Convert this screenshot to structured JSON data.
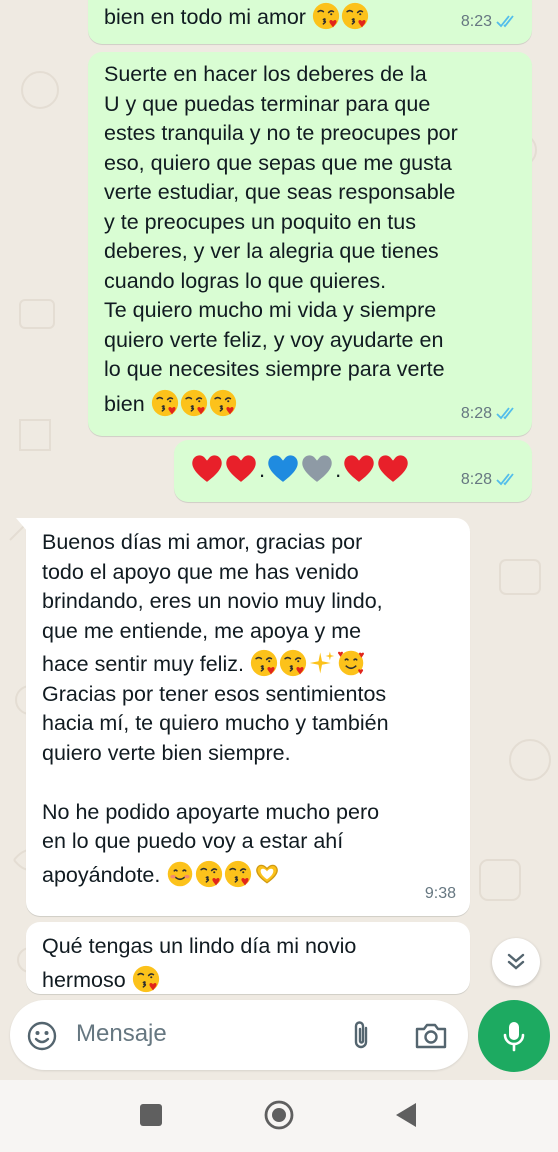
{
  "colors": {
    "outgoing_bubble": "#d9fdd3",
    "incoming_bubble": "#ffffff",
    "read_ticks": "#53bdeb",
    "mic_button": "#1daa61",
    "background": "#efeae2"
  },
  "messages": [
    {
      "direction": "outgoing",
      "lines": [
        "bien en todo mi amor"
      ],
      "emojis": [
        "kissing-heart-emoji",
        "kissing-heart-emoji"
      ],
      "time": "8:23",
      "status": "read"
    },
    {
      "direction": "outgoing",
      "lines": [
        "Suerte en hacer los deberes de la",
        "U y que puedas terminar para que",
        "estes tranquila y no te preocupes por",
        "eso, quiero que sepas que me gusta",
        "verte estudiar, que seas responsable",
        "y te preocupes un poquito en tus",
        "deberes, y ver la alegria que tienes",
        "cuando logras lo que quieres.",
        "Te quiero mucho mi vida y siempre",
        "quiero verte feliz, y voy ayudarte en",
        "lo que necesites siempre para verte",
        "bien"
      ],
      "emojis": [
        "kissing-heart-emoji",
        "kissing-heart-emoji",
        "kissing-heart-emoji"
      ],
      "time": "8:28",
      "status": "read"
    },
    {
      "direction": "outgoing",
      "hearts": [
        "red",
        "red",
        ".",
        "blue",
        "grey",
        ".",
        "red",
        "red"
      ],
      "time": "8:28",
      "status": "read"
    },
    {
      "direction": "incoming",
      "lines": [
        "Buenos días mi amor, gracias por",
        "todo el apoyo que me has venido",
        "brindando, eres un novio muy lindo,",
        "que me entiende, me apoya y me",
        "hace sentir muy feliz.",
        "Gracias por tener esos sentimientos",
        "hacia mí, te quiero mucho y también",
        "quiero verte bien siempre.",
        "",
        "No he podido apoyarte mucho pero",
        "en lo que puedo voy a estar ahí",
        "apoyándote."
      ],
      "time": "9:38"
    },
    {
      "direction": "incoming",
      "lines": [
        "Qué tengas un lindo día mi novio",
        "hermoso"
      ],
      "emojis": [
        "kissing-heart-emoji"
      ]
    }
  ],
  "composer": {
    "placeholder": "Mensaje",
    "icons": [
      "smile-icon",
      "paperclip-icon",
      "camera-icon",
      "mic-icon"
    ]
  },
  "navbar": {
    "buttons": [
      "recents-button",
      "home-button",
      "back-button"
    ]
  }
}
